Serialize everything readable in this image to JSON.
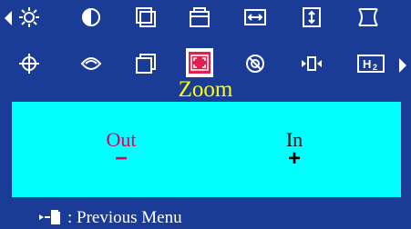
{
  "menu": {
    "title": "Zoom",
    "selected_icon": "zoom-icon",
    "top_row_icons": [
      "brightness-icon",
      "contrast-icon",
      "horizontal-position-icon",
      "vertical-position-icon",
      "horizontal-size-icon",
      "vertical-size-icon",
      "pincushion-icon"
    ],
    "bottom_row_icons": [
      "rotation-icon",
      "moire-icon",
      "trapezoid-icon",
      "zoom-icon",
      "degauss-icon",
      "linearity-icon",
      "h2-icon"
    ]
  },
  "zoom": {
    "out_label": "Out",
    "out_sign": "−",
    "in_label": "In",
    "in_sign": "+"
  },
  "footer": {
    "label": ": Previous Menu"
  },
  "colors": {
    "background": "#1a3c96",
    "title": "#ffff00",
    "panel": "#00ffff",
    "out_text": "#e0005a",
    "in_text": "#000000",
    "selected_icon_bg": "#e02050",
    "icon": "#ffffff"
  }
}
